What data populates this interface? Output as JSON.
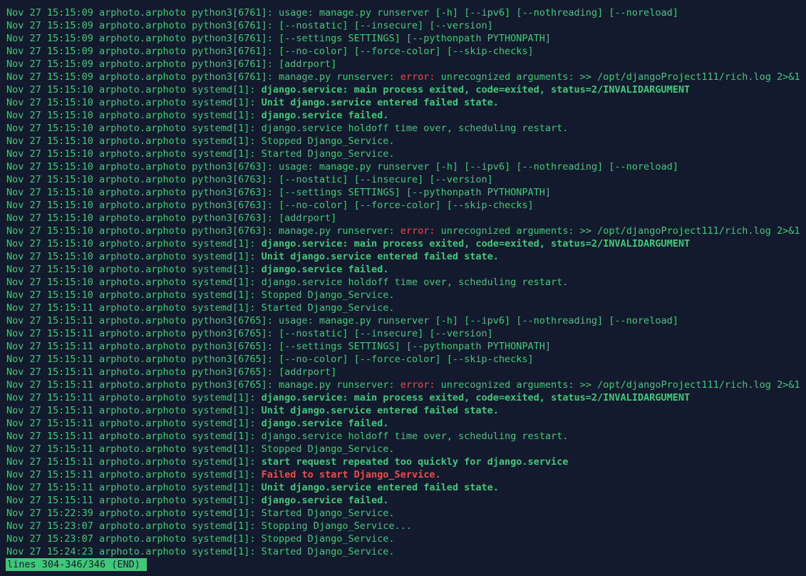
{
  "lines": [
    {
      "prefix": "Nov 27 15:15:09 arphoto.arphoto python3[6761]: ",
      "text": "usage: manage.py runserver [-h] [--ipv6] [--nothreading] [--noreload]"
    },
    {
      "prefix": "Nov 27 15:15:09 arphoto.arphoto python3[6761]: ",
      "text": "[--nostatic] [--insecure] [--version]"
    },
    {
      "prefix": "Nov 27 15:15:09 arphoto.arphoto python3[6761]: ",
      "text": "[--settings SETTINGS] [--pythonpath PYTHONPATH]"
    },
    {
      "prefix": "Nov 27 15:15:09 arphoto.arphoto python3[6761]: ",
      "text": "[--no-color] [--force-color] [--skip-checks]"
    },
    {
      "prefix": "Nov 27 15:15:09 arphoto.arphoto python3[6761]: ",
      "text": "[addrport]"
    },
    {
      "prefix": "Nov 27 15:15:09 arphoto.arphoto python3[6761]: ",
      "text": "manage.py runserver: ",
      "error": "error:",
      "rest": " unrecognized arguments: >> /opt/djangoProject111/rich.log 2>&1"
    },
    {
      "prefix": "Nov 27 15:15:10 arphoto.arphoto systemd[1]: ",
      "bold": "django.service: main process exited, code=exited, status=2/INVALIDARGUMENT"
    },
    {
      "prefix": "Nov 27 15:15:10 arphoto.arphoto systemd[1]: ",
      "bold": "Unit django.service entered failed state."
    },
    {
      "prefix": "Nov 27 15:15:10 arphoto.arphoto systemd[1]: ",
      "bold": "django.service failed."
    },
    {
      "prefix": "Nov 27 15:15:10 arphoto.arphoto systemd[1]: ",
      "text": "django.service holdoff time over, scheduling restart."
    },
    {
      "prefix": "Nov 27 15:15:10 arphoto.arphoto systemd[1]: ",
      "text": "Stopped Django_Service."
    },
    {
      "prefix": "Nov 27 15:15:10 arphoto.arphoto systemd[1]: ",
      "text": "Started Django_Service."
    },
    {
      "prefix": "Nov 27 15:15:10 arphoto.arphoto python3[6763]: ",
      "text": "usage: manage.py runserver [-h] [--ipv6] [--nothreading] [--noreload]"
    },
    {
      "prefix": "Nov 27 15:15:10 arphoto.arphoto python3[6763]: ",
      "text": "[--nostatic] [--insecure] [--version]"
    },
    {
      "prefix": "Nov 27 15:15:10 arphoto.arphoto python3[6763]: ",
      "text": "[--settings SETTINGS] [--pythonpath PYTHONPATH]"
    },
    {
      "prefix": "Nov 27 15:15:10 arphoto.arphoto python3[6763]: ",
      "text": "[--no-color] [--force-color] [--skip-checks]"
    },
    {
      "prefix": "Nov 27 15:15:10 arphoto.arphoto python3[6763]: ",
      "text": "[addrport]"
    },
    {
      "prefix": "Nov 27 15:15:10 arphoto.arphoto python3[6763]: ",
      "text": "manage.py runserver: ",
      "error": "error:",
      "rest": " unrecognized arguments: >> /opt/djangoProject111/rich.log 2>&1"
    },
    {
      "prefix": "Nov 27 15:15:10 arphoto.arphoto systemd[1]: ",
      "bold": "django.service: main process exited, code=exited, status=2/INVALIDARGUMENT"
    },
    {
      "prefix": "Nov 27 15:15:10 arphoto.arphoto systemd[1]: ",
      "bold": "Unit django.service entered failed state."
    },
    {
      "prefix": "Nov 27 15:15:10 arphoto.arphoto systemd[1]: ",
      "bold": "django.service failed."
    },
    {
      "prefix": "Nov 27 15:15:10 arphoto.arphoto systemd[1]: ",
      "text": "django.service holdoff time over, scheduling restart."
    },
    {
      "prefix": "Nov 27 15:15:10 arphoto.arphoto systemd[1]: ",
      "text": "Stopped Django_Service."
    },
    {
      "prefix": "Nov 27 15:15:11 arphoto.arphoto systemd[1]: ",
      "text": "Started Django_Service."
    },
    {
      "prefix": "Nov 27 15:15:11 arphoto.arphoto python3[6765]: ",
      "text": "usage: manage.py runserver [-h] [--ipv6] [--nothreading] [--noreload]"
    },
    {
      "prefix": "Nov 27 15:15:11 arphoto.arphoto python3[6765]: ",
      "text": "[--nostatic] [--insecure] [--version]"
    },
    {
      "prefix": "Nov 27 15:15:11 arphoto.arphoto python3[6765]: ",
      "text": "[--settings SETTINGS] [--pythonpath PYTHONPATH]"
    },
    {
      "prefix": "Nov 27 15:15:11 arphoto.arphoto python3[6765]: ",
      "text": "[--no-color] [--force-color] [--skip-checks]"
    },
    {
      "prefix": "Nov 27 15:15:11 arphoto.arphoto python3[6765]: ",
      "text": "[addrport]"
    },
    {
      "prefix": "Nov 27 15:15:11 arphoto.arphoto python3[6765]: ",
      "text": "manage.py runserver: ",
      "error": "error:",
      "rest": " unrecognized arguments: >> /opt/djangoProject111/rich.log 2>&1"
    },
    {
      "prefix": "Nov 27 15:15:11 arphoto.arphoto systemd[1]: ",
      "bold": "django.service: main process exited, code=exited, status=2/INVALIDARGUMENT"
    },
    {
      "prefix": "Nov 27 15:15:11 arphoto.arphoto systemd[1]: ",
      "bold": "Unit django.service entered failed state."
    },
    {
      "prefix": "Nov 27 15:15:11 arphoto.arphoto systemd[1]: ",
      "bold": "django.service failed."
    },
    {
      "prefix": "Nov 27 15:15:11 arphoto.arphoto systemd[1]: ",
      "text": "django.service holdoff time over, scheduling restart."
    },
    {
      "prefix": "Nov 27 15:15:11 arphoto.arphoto systemd[1]: ",
      "text": "Stopped Django_Service."
    },
    {
      "prefix": "Nov 27 15:15:11 arphoto.arphoto systemd[1]: ",
      "bold": "start request repeated too quickly for django.service"
    },
    {
      "prefix": "Nov 27 15:15:11 arphoto.arphoto systemd[1]: ",
      "fail": "Failed to start Django_Service."
    },
    {
      "prefix": "Nov 27 15:15:11 arphoto.arphoto systemd[1]: ",
      "bold": "Unit django.service entered failed state."
    },
    {
      "prefix": "Nov 27 15:15:11 arphoto.arphoto systemd[1]: ",
      "bold": "django.service failed."
    },
    {
      "prefix": "Nov 27 15:22:39 arphoto.arphoto systemd[1]: ",
      "text": "Started Django_Service."
    },
    {
      "prefix": "Nov 27 15:23:07 arphoto.arphoto systemd[1]: ",
      "text": "Stopping Django_Service..."
    },
    {
      "prefix": "Nov 27 15:23:07 arphoto.arphoto systemd[1]: ",
      "text": "Stopped Django_Service."
    },
    {
      "prefix": "Nov 27 15:24:23 arphoto.arphoto systemd[1]: ",
      "text": "Started Django_Service."
    }
  ],
  "status_bar": "lines 304-346/346 (END)",
  "colors": {
    "background": "#141a2e",
    "text": "#3ec97a",
    "error": "#f04a4a"
  }
}
